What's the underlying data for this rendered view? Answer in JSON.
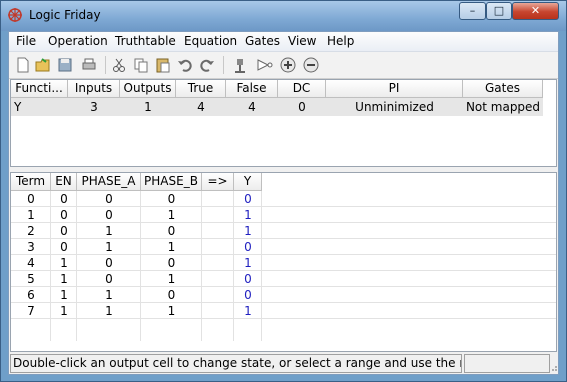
{
  "window": {
    "title": "Logic Friday",
    "minimize": "–",
    "maximize": "□",
    "close": "✕"
  },
  "menu": [
    "File",
    "Operation",
    "Truthtable",
    "Equation",
    "Gates",
    "View",
    "Help"
  ],
  "toolbar_icons": [
    "new-file-icon",
    "open-folder-icon",
    "save-icon",
    "print-icon",
    "cut-icon",
    "copy-icon",
    "paste-icon",
    "undo-icon",
    "redo-icon",
    "gate-icon",
    "buffer-icon",
    "zoom-in-icon",
    "zoom-out-icon"
  ],
  "functions": {
    "headers": [
      "Functi...",
      "Inputs",
      "Outputs",
      "True",
      "False",
      "DC",
      "PI",
      "Gates"
    ],
    "rows": [
      [
        "Y",
        "3",
        "1",
        "4",
        "4",
        "0",
        "Unminimized",
        "Not mapped"
      ]
    ]
  },
  "truthtable": {
    "headers": [
      "Term",
      "EN",
      "PHASE_A",
      "PHASE_B",
      "=>",
      "Y"
    ],
    "rows": [
      [
        "0",
        "0",
        "0",
        "0",
        "",
        "0"
      ],
      [
        "1",
        "0",
        "0",
        "1",
        "",
        "1"
      ],
      [
        "2",
        "0",
        "1",
        "0",
        "",
        "1"
      ],
      [
        "3",
        "0",
        "1",
        "1",
        "",
        "0"
      ],
      [
        "4",
        "1",
        "0",
        "0",
        "",
        "1"
      ],
      [
        "5",
        "1",
        "0",
        "1",
        "",
        "0"
      ],
      [
        "6",
        "1",
        "1",
        "0",
        "",
        "0"
      ],
      [
        "7",
        "1",
        "1",
        "1",
        "",
        "1"
      ]
    ]
  },
  "status": {
    "message": "Double-click an output cell to change state, or select a range and use the menu. Press"
  },
  "colors": {
    "output_value": "#1f1fbf",
    "selected_row": "#e6e6e6"
  }
}
